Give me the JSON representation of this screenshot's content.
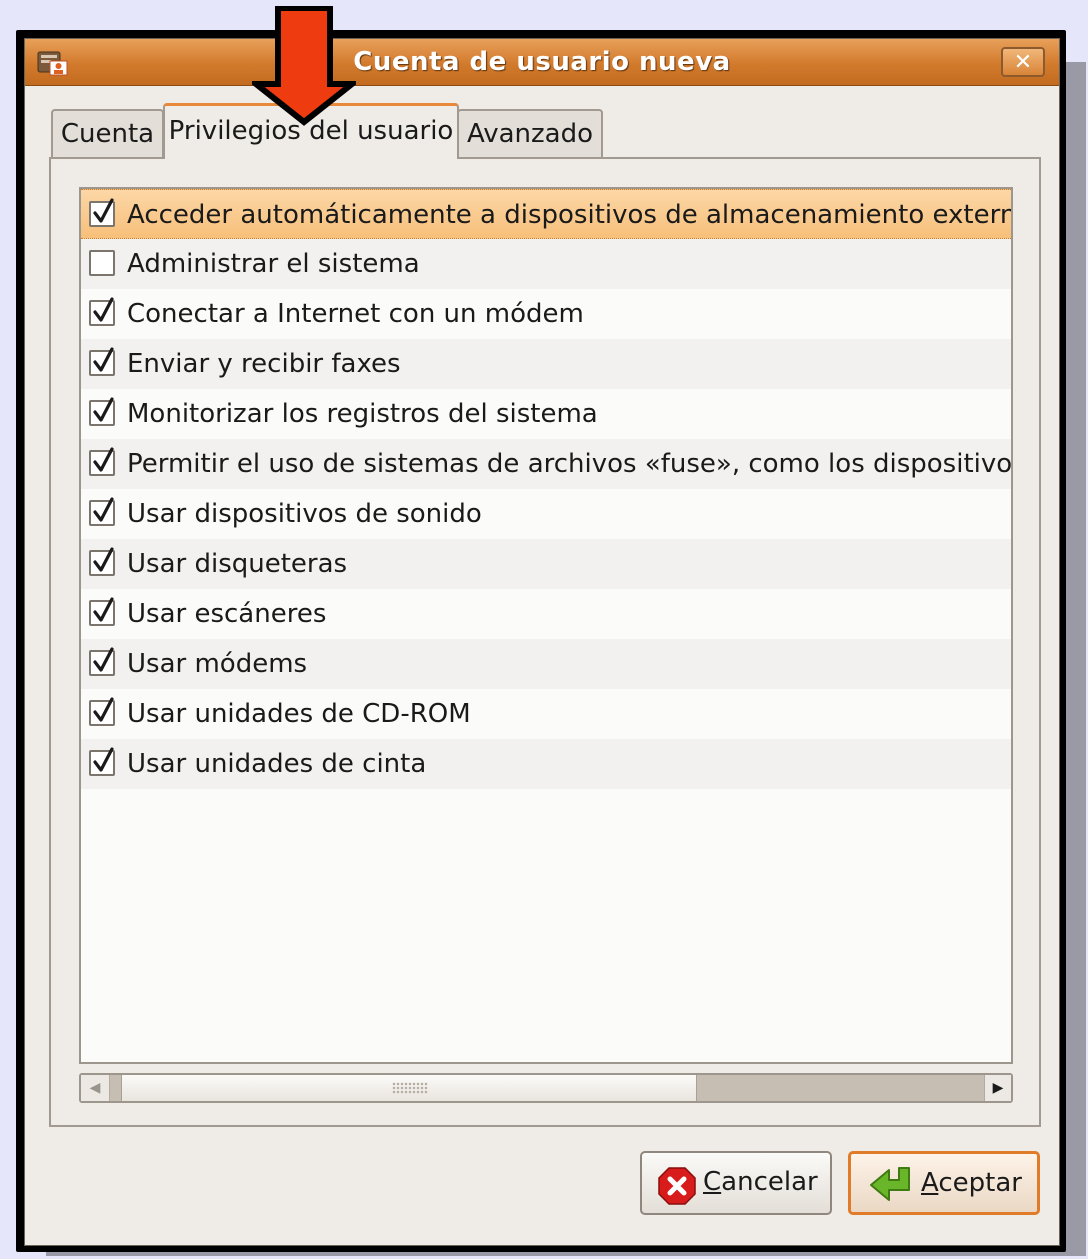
{
  "window": {
    "title": "Cuenta de usuario nueva",
    "close_label": "✕"
  },
  "tabs": [
    {
      "label": "Cuenta",
      "active": false
    },
    {
      "label": "Privilegios del usuario",
      "active": true
    },
    {
      "label": "Avanzado",
      "active": false
    }
  ],
  "privileges": [
    {
      "label": "Acceder automáticamente a dispositivos de almacenamiento externo",
      "checked": true,
      "selected": true
    },
    {
      "label": "Administrar el sistema",
      "checked": false
    },
    {
      "label": "Conectar a Internet con un módem",
      "checked": true
    },
    {
      "label": "Enviar y recibir faxes",
      "checked": true
    },
    {
      "label": "Monitorizar los registros del sistema",
      "checked": true
    },
    {
      "label": "Permitir el uso de sistemas de archivos «fuse», como los dispositivos",
      "checked": true
    },
    {
      "label": "Usar dispositivos de sonido",
      "checked": true
    },
    {
      "label": "Usar disqueteras",
      "checked": true
    },
    {
      "label": "Usar escáneres",
      "checked": true
    },
    {
      "label": "Usar módems",
      "checked": true
    },
    {
      "label": "Usar unidades de CD-ROM",
      "checked": true
    },
    {
      "label": "Usar unidades de cinta",
      "checked": true
    }
  ],
  "buttons": {
    "cancel": {
      "mnemonic": "C",
      "rest": "ancelar"
    },
    "accept": {
      "mnemonic": "A",
      "rest": "ceptar"
    }
  },
  "colors": {
    "accent": "#e8883a",
    "annotation_arrow": "#ee3b10",
    "selection": "#f7bf7a",
    "background": "#e6e6fa"
  },
  "icons": {
    "title": "user-account-icon",
    "cancel": "cancel-x-icon",
    "accept": "green-arrow-icon",
    "annotation": "red-down-arrow"
  }
}
